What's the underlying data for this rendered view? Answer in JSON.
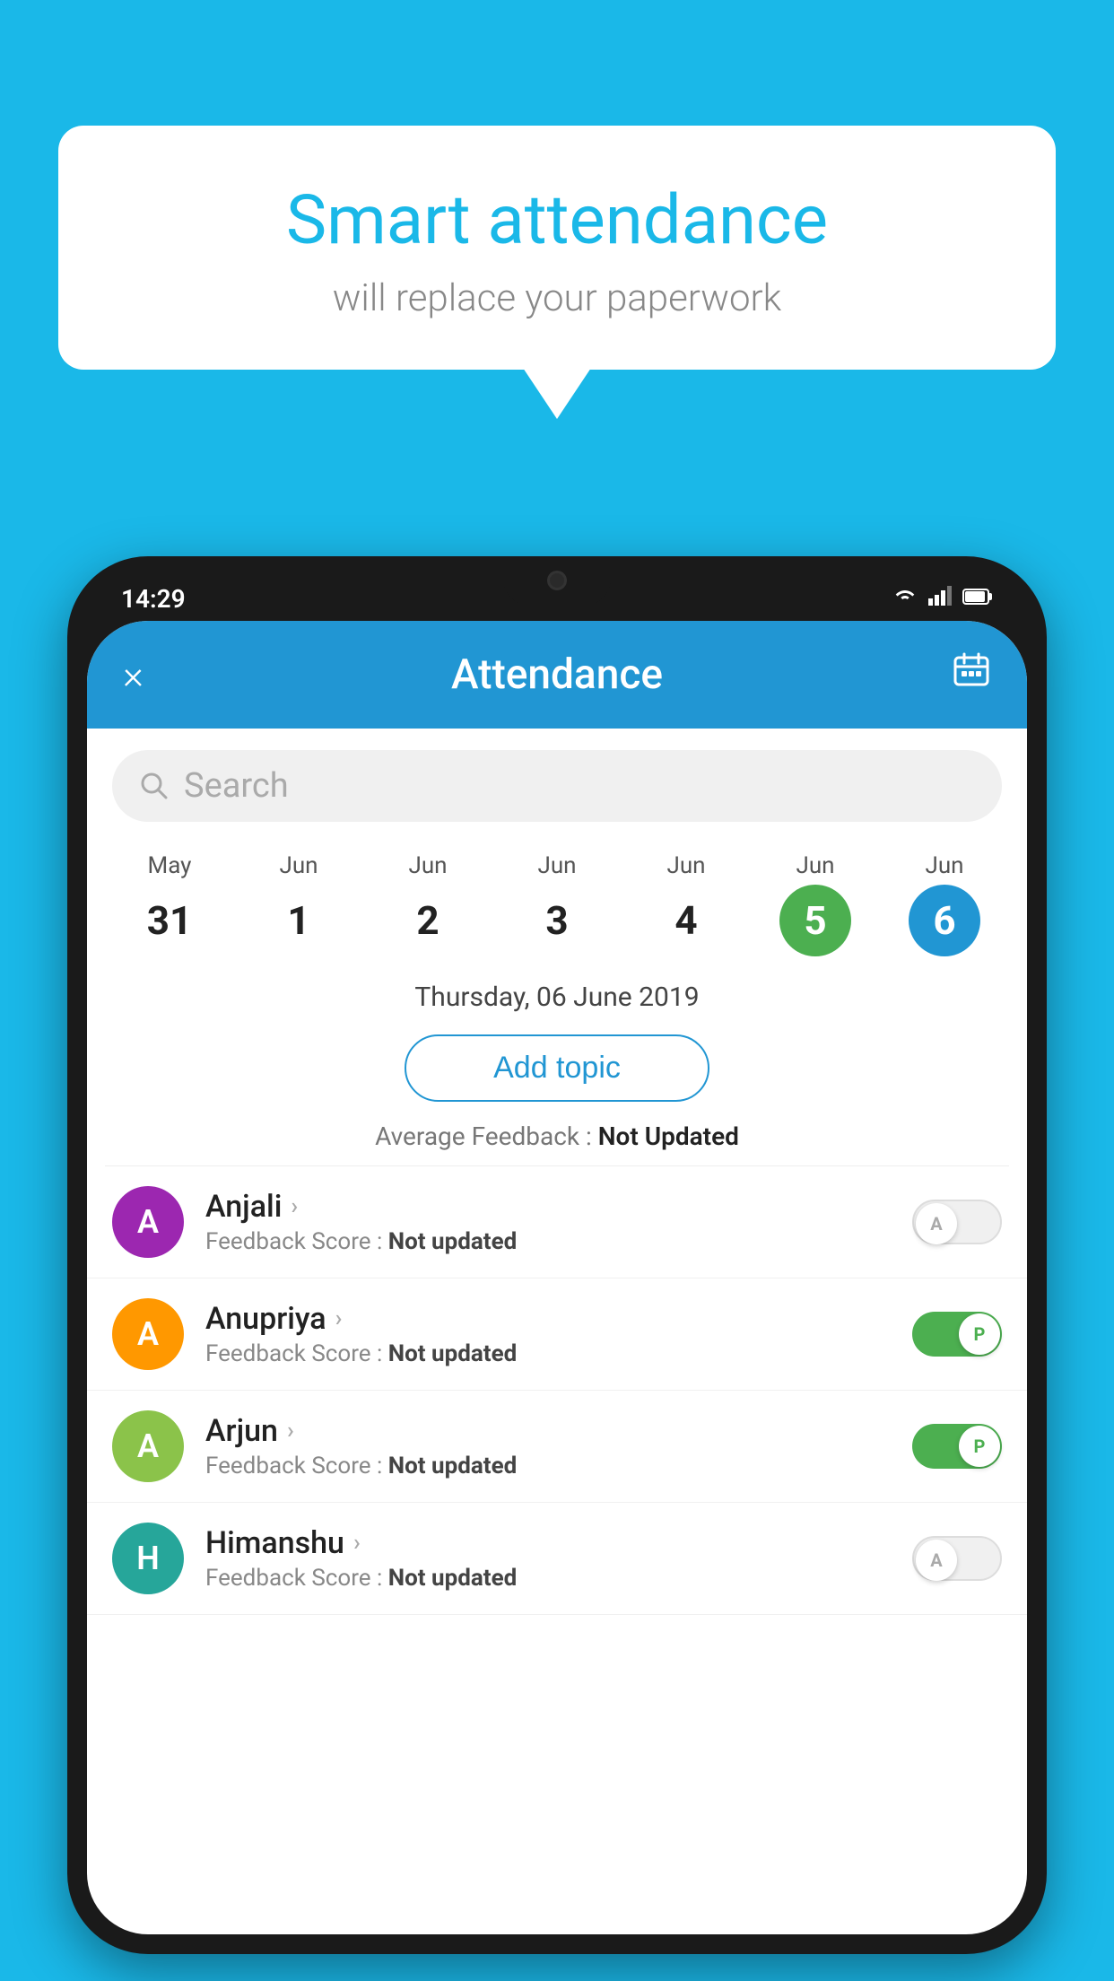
{
  "background_color": "#1ab8e8",
  "bubble": {
    "title": "Smart attendance",
    "subtitle": "will replace your paperwork"
  },
  "status_bar": {
    "time": "14:29",
    "wifi": "wifi-icon",
    "signal": "signal-icon",
    "battery": "battery-icon"
  },
  "app_header": {
    "title": "Attendance",
    "close_label": "×",
    "calendar_icon": "calendar-icon"
  },
  "search": {
    "placeholder": "Search"
  },
  "calendar": {
    "days": [
      {
        "month": "May",
        "date": "31",
        "state": "normal"
      },
      {
        "month": "Jun",
        "date": "1",
        "state": "normal"
      },
      {
        "month": "Jun",
        "date": "2",
        "state": "normal"
      },
      {
        "month": "Jun",
        "date": "3",
        "state": "normal"
      },
      {
        "month": "Jun",
        "date": "4",
        "state": "normal"
      },
      {
        "month": "Jun",
        "date": "5",
        "state": "today"
      },
      {
        "month": "Jun",
        "date": "6",
        "state": "selected"
      }
    ]
  },
  "selected_date_label": "Thursday, 06 June 2019",
  "add_topic_label": "Add topic",
  "avg_feedback": {
    "label": "Average Feedback : ",
    "value": "Not Updated"
  },
  "students": [
    {
      "name": "Anjali",
      "avatar_letter": "A",
      "avatar_color": "purple",
      "feedback_label": "Feedback Score : ",
      "feedback_value": "Not updated",
      "attendance": "absent",
      "toggle_label": "A"
    },
    {
      "name": "Anupriya",
      "avatar_letter": "A",
      "avatar_color": "orange",
      "feedback_label": "Feedback Score : ",
      "feedback_value": "Not updated",
      "attendance": "present",
      "toggle_label": "P"
    },
    {
      "name": "Arjun",
      "avatar_letter": "A",
      "avatar_color": "green",
      "feedback_label": "Feedback Score : ",
      "feedback_value": "Not updated",
      "attendance": "present",
      "toggle_label": "P"
    },
    {
      "name": "Himanshu",
      "avatar_letter": "H",
      "avatar_color": "teal",
      "feedback_label": "Feedback Score : ",
      "feedback_value": "Not updated",
      "attendance": "absent",
      "toggle_label": "A"
    }
  ]
}
